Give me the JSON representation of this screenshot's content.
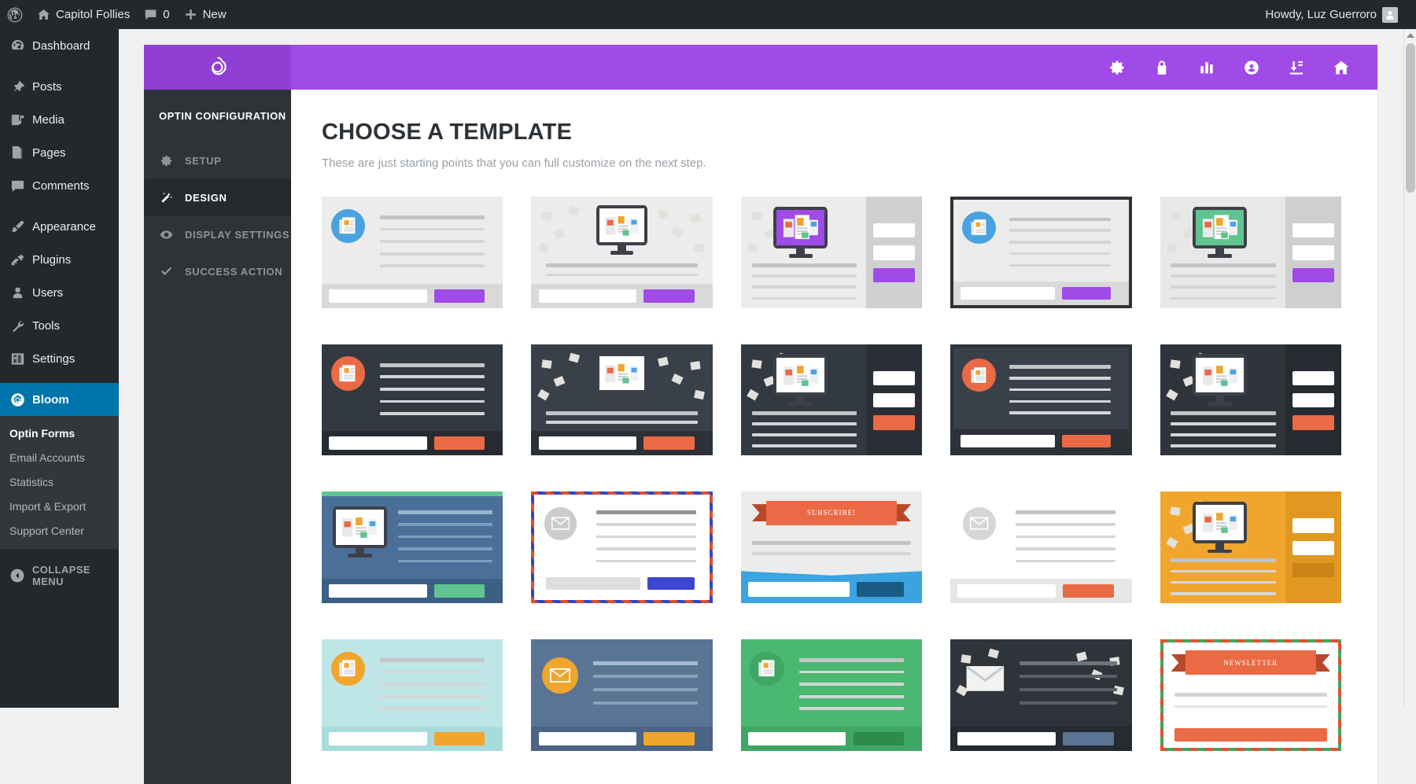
{
  "adminbar": {
    "logo_icon": "wordpress-icon",
    "site_name": "Capitol Follies",
    "site_icon": "home-icon",
    "comments_icon": "comment-bubble-icon",
    "comments_count": "0",
    "new_icon": "plus-icon",
    "new_label": "New",
    "greeting": "Howdy, Luz Guerroro",
    "avatar_icon": "user-avatar-icon"
  },
  "sidebar": {
    "items": [
      {
        "label": "Dashboard",
        "icon": "dashboard-icon",
        "current": false
      },
      {
        "label": "Posts",
        "icon": "pin-icon",
        "current": false
      },
      {
        "label": "Media",
        "icon": "media-icon",
        "current": false
      },
      {
        "label": "Pages",
        "icon": "pages-icon",
        "current": false
      },
      {
        "label": "Comments",
        "icon": "comment-bubble-icon",
        "current": false
      },
      {
        "label": "Appearance",
        "icon": "paintbrush-icon",
        "current": false
      },
      {
        "label": "Plugins",
        "icon": "plug-icon",
        "current": false
      },
      {
        "label": "Users",
        "icon": "user-icon",
        "current": false
      },
      {
        "label": "Tools",
        "icon": "wrench-icon",
        "current": false
      },
      {
        "label": "Settings",
        "icon": "settings-sliders-icon",
        "current": false
      },
      {
        "label": "Bloom",
        "icon": "bloom-flower-icon",
        "current": true
      }
    ],
    "submenu": [
      {
        "label": "Optin Forms",
        "current": true
      },
      {
        "label": "Email Accounts",
        "current": false
      },
      {
        "label": "Statistics",
        "current": false
      },
      {
        "label": "Import & Export",
        "current": false
      },
      {
        "label": "Support Center",
        "current": false
      }
    ],
    "collapse_label": "COLLAPSE MENU",
    "collapse_icon": "collapse-arrow-icon"
  },
  "bloom": {
    "brand_icon": "bloom-flower-icon",
    "header_icons": [
      {
        "name": "gear-icon"
      },
      {
        "name": "lock-icon"
      },
      {
        "name": "bar-chart-icon"
      },
      {
        "name": "support-circle-icon"
      },
      {
        "name": "import-export-icon"
      },
      {
        "name": "home-icon"
      }
    ],
    "nav": {
      "title": "OPTIN CONFIGURATION",
      "items": [
        {
          "label": "SETUP",
          "icon": "gear-icon",
          "active": false
        },
        {
          "label": "DESIGN",
          "icon": "magic-wand-icon",
          "active": true
        },
        {
          "label": "DISPLAY SETTINGS",
          "icon": "eye-icon",
          "active": false
        },
        {
          "label": "SUCCESS ACTION",
          "icon": "check-icon",
          "active": false
        }
      ]
    },
    "main": {
      "title": "CHOOSE A TEMPLATE",
      "subtitle": "These are just starting points that you can full customize on the next step."
    },
    "colors": {
      "brand_purple": "#a04ae8",
      "brand_purple_dark": "#8f3fd4",
      "selected_outline": "#30c7d3",
      "accent_orange": "#ea6a45",
      "accent_blue": "#3ba4e0",
      "accent_green": "#5fc48f",
      "accent_yellow": "#f0a52c"
    },
    "templates": [
      {
        "id": 1,
        "layout": "circle-left",
        "bg": "#ececec",
        "icon": "newspaper-icon",
        "icon_bg": "#4aa3e0",
        "bar_bg": "#d9d9d9",
        "field": "#ffffff",
        "button": "#a04ae8",
        "selected": false,
        "framed": false
      },
      {
        "id": 2,
        "layout": "monitor-center",
        "bg": "#ececec",
        "icon": "monitor-icon",
        "icon_bg": "#ffffff",
        "bar_bg": "#d9d9d9",
        "field": "#ffffff",
        "button": "#a04ae8",
        "selected": false,
        "framed": false
      },
      {
        "id": 3,
        "layout": "monitor-side",
        "bg": "#ececec",
        "icon": "monitor-icon",
        "icon_bg": "#a04ae8",
        "bar_bg": "#d0d0d0",
        "field": "#ffffff",
        "button": "#a04ae8",
        "selected": true,
        "framed": false
      },
      {
        "id": 4,
        "layout": "circle-left",
        "bg": "#ececec",
        "icon": "newspaper-icon",
        "icon_bg": "#4aa3e0",
        "bar_bg": "#d9d9d9",
        "field": "#ffffff",
        "button": "#a04ae8",
        "selected": false,
        "framed": true
      },
      {
        "id": 5,
        "layout": "monitor-side",
        "bg": "#e8e8e8",
        "icon": "monitor-icon",
        "icon_bg": "#5fc48f",
        "bar_bg": "#cfcfcf",
        "field": "#ffffff",
        "button": "#a04ae8",
        "selected": false,
        "framed": false
      },
      {
        "id": 6,
        "layout": "circle-left",
        "bg": "#333941",
        "icon": "newspaper-icon",
        "icon_bg": "#ea6a45",
        "bar_bg": "#262b31",
        "field": "#ffffff",
        "button": "#ea6a45",
        "selected": false,
        "framed": false
      },
      {
        "id": 7,
        "layout": "monitor-center",
        "bg": "#3a4049",
        "icon": "monitor-icon",
        "icon_bg": "#ffffff",
        "bar_bg": "#2c3138",
        "field": "#ffffff",
        "button": "#ea6a45",
        "selected": false,
        "framed": false
      },
      {
        "id": 8,
        "layout": "monitor-side",
        "bg": "#333941",
        "icon": "monitor-icon",
        "icon_bg": "#ffffff",
        "bar_bg": "#2a2f35",
        "field": "#ffffff",
        "button": "#ea6a45",
        "selected": false,
        "framed": false
      },
      {
        "id": 9,
        "layout": "circle-left",
        "bg": "#3a4049",
        "icon": "newspaper-icon",
        "icon_bg": "#ea6a45",
        "bar_bg": "#2c3138",
        "field": "#ffffff",
        "button": "#ea6a45",
        "selected": false,
        "framed": true
      },
      {
        "id": 10,
        "layout": "monitor-side",
        "bg": "#2f343b",
        "icon": "monitor-icon",
        "icon_bg": "#ffffff",
        "bar_bg": "#262b31",
        "field": "#ffffff",
        "button": "#ea6a45",
        "selected": false,
        "framed": false
      },
      {
        "id": 11,
        "layout": "monitor-flat",
        "bg": "#4a7099",
        "icon": "monitor-icon",
        "icon_bg": "#ffffff",
        "bar_bg": "#3d5f84",
        "field": "#ffffff",
        "button": "#5fc48f",
        "selected": false,
        "framed": false
      },
      {
        "id": 12,
        "layout": "envelope-dash",
        "bg": "#ffffff",
        "icon": "envelope-icon",
        "icon_bg": "#cccccc",
        "bar_bg": "#ffffff",
        "field": "#dedede",
        "button": "#3c46d2",
        "selected": false,
        "framed": false
      },
      {
        "id": 13,
        "layout": "ribbon-blue",
        "bg": "#ececec",
        "ribbon_text": "SUBSCRIBE!",
        "ribbon_color": "#ea6a45",
        "bar_bg": "#3ba4e0",
        "field": "#ffffff",
        "button": "#1b5a84",
        "selected": false,
        "framed": false
      },
      {
        "id": 14,
        "layout": "envelope-top",
        "bg": "#ffffff",
        "icon": "envelope-icon",
        "icon_bg": "#d6d6d6",
        "bar_bg": "#e6e6e6",
        "field": "#ffffff",
        "button": "#ea6a45",
        "selected": false,
        "framed": false
      },
      {
        "id": 15,
        "layout": "monitor-side",
        "bg": "#f0a52c",
        "icon": "monitor-icon",
        "icon_bg": "#ffffff",
        "bar_bg": "#e09820",
        "field": "#ffffff",
        "button": "#c98318",
        "selected": false,
        "framed": false
      },
      {
        "id": 16,
        "layout": "circle-left",
        "bg": "#bfe6e6",
        "icon": "newspaper-icon",
        "icon_bg": "#f0a52c",
        "bar_bg": "#a8dcdc",
        "field": "#ffffff",
        "button": "#f0a52c",
        "selected": false,
        "framed": false
      },
      {
        "id": 17,
        "layout": "envelope-left",
        "bg": "#5a7494",
        "icon": "envelope-icon",
        "icon_bg": "#f0a52c",
        "bar_bg": "#4c6483",
        "field": "#ffffff",
        "button": "#f0a52c",
        "selected": false,
        "framed": false
      },
      {
        "id": 18,
        "layout": "circle-left",
        "bg": "#4ab870",
        "icon": "newspaper-icon",
        "icon_bg": "#3fa763",
        "bar_bg": "#3fa763",
        "field": "#ffffff",
        "button": "#2e8b4c",
        "selected": false,
        "framed": false
      },
      {
        "id": 19,
        "layout": "mail-dark",
        "bg": "#2f343b",
        "icon": "envelope-icon",
        "icon_bg": "#ffffff",
        "bar_bg": "#262b31",
        "field": "#ffffff",
        "button": "#5a7494",
        "selected": false,
        "framed": false
      },
      {
        "id": 20,
        "layout": "ribbon-dash",
        "bg": "#ffffff",
        "ribbon_text": "NEWSLETTER",
        "ribbon_color": "#ea6a45",
        "bar_bg": "#ffffff",
        "field": "#ffffff",
        "button": "#ea6a45",
        "selected": false,
        "framed": false
      }
    ]
  }
}
